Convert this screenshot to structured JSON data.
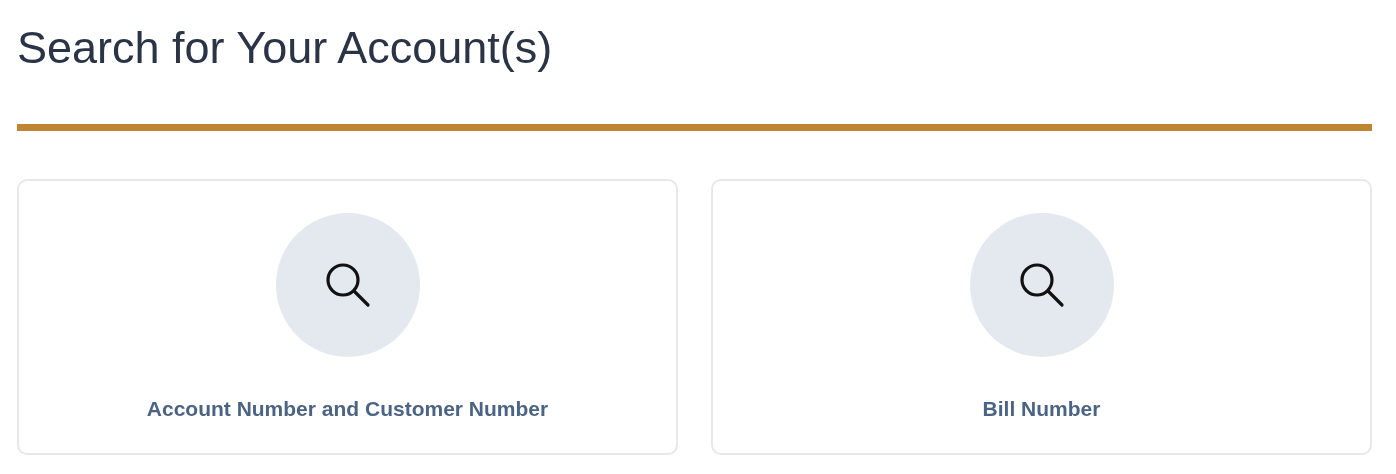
{
  "heading": "Search for Your Account(s)",
  "options": [
    {
      "label": "Account Number and Customer Number"
    },
    {
      "label": "Bill Number"
    }
  ]
}
